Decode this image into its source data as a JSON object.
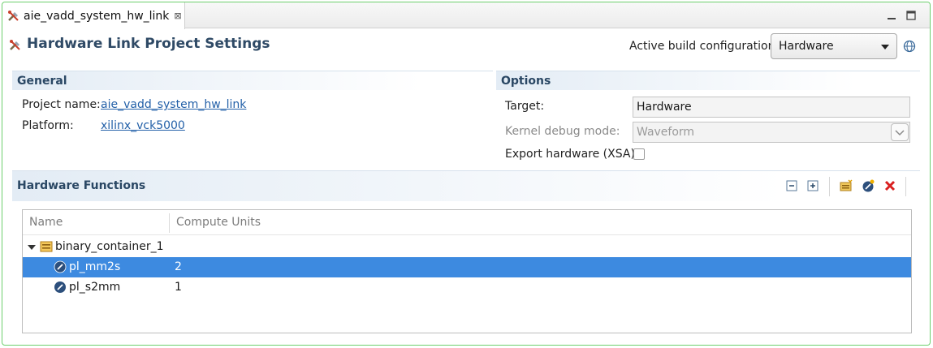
{
  "tab": {
    "title": "aie_vadd_system_hw_link",
    "close_glyph": "⊠",
    "icon": "tools-icon"
  },
  "window_controls": {
    "minimize": "minimize-icon",
    "maximize": "maximize-icon"
  },
  "header": {
    "title": "Hardware Link Project Settings",
    "icon": "tools-icon",
    "build_config_label": "Active build configuration:",
    "build_config_value": "Hardware",
    "globe_icon": "globe-icon"
  },
  "general": {
    "title": "General",
    "project_name_label": "Project name:",
    "project_name_value": "aie_vadd_system_hw_link",
    "platform_label": "Platform:",
    "platform_value": "xilinx_vck5000"
  },
  "options": {
    "title": "Options",
    "target_label": "Target:",
    "target_value": "Hardware",
    "kernel_debug_label": "Kernel debug mode:",
    "kernel_debug_value": "Waveform",
    "export_label": "Export hardware (XSA):",
    "export_checked": false
  },
  "hw_functions": {
    "title": "Hardware Functions",
    "toolbar": [
      "collapse-all-icon",
      "expand-all-icon",
      "add-binary-container-icon",
      "add-function-icon",
      "remove-icon"
    ],
    "columns": [
      "Name",
      "Compute Units"
    ],
    "rows": [
      {
        "name": "binary_container_1",
        "cu": "",
        "level": 0,
        "expanded": true,
        "icon": "container-icon"
      },
      {
        "name": "pl_mm2s",
        "cu": "2",
        "level": 1,
        "selected": true,
        "icon": "function-icon"
      },
      {
        "name": "pl_s2mm",
        "cu": "1",
        "level": 1,
        "selected": false,
        "icon": "function-icon"
      }
    ]
  },
  "colors": {
    "accent_title": "#2f4a66",
    "link": "#2360a8",
    "selection": "#3d8ae0",
    "frame_border": "#6dcf6d"
  }
}
